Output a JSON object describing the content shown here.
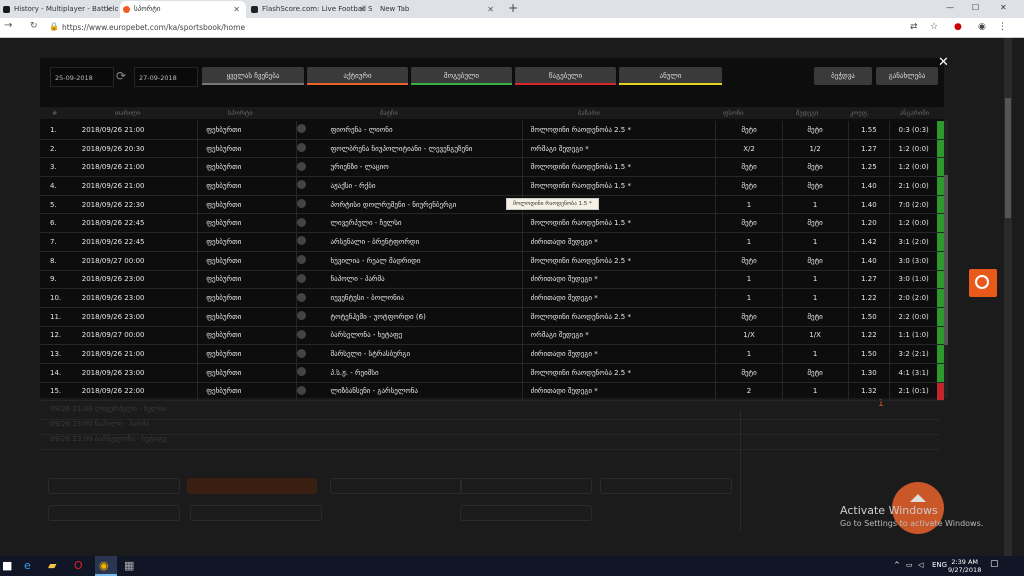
{
  "browser": {
    "tabs": [
      {
        "title": "History - Multiplayer - Battlelog",
        "active": false,
        "favicon_color": "#1a1a1a"
      },
      {
        "title": "სპორტი",
        "active": true,
        "favicon_color": "#f15a24"
      },
      {
        "title": "FlashScore.com: Live Football Sc",
        "active": false,
        "favicon_color": "#222222"
      },
      {
        "title": "New Tab",
        "active": false,
        "favicon_color": ""
      }
    ],
    "url": "https://www.europebet.com/ka/sportsbook/home"
  },
  "filters": {
    "date_from": "25-09-2018",
    "date_to": "27-09-2018",
    "buttons": [
      {
        "label": "ყველას ჩვენება",
        "color": "#777777"
      },
      {
        "label": "აქტიური",
        "color": "#e8622a"
      },
      {
        "label": "მოგებული",
        "color": "#3cb043"
      },
      {
        "label": "წაგებული",
        "color": "#d9262c"
      },
      {
        "label": "ანული",
        "color": "#e6d21e"
      }
    ],
    "right_buttons": [
      "ბეჭდვა",
      "განახლება"
    ]
  },
  "table": {
    "headers": [
      "#",
      "თარიღი",
      "სპორტი",
      "მატჩი",
      "ბაზარი",
      "ფსონი",
      "შედეგი",
      "კოეფ.",
      "ანგარიში"
    ],
    "rows": [
      {
        "num": "1.",
        "date": "2018/09/26 21:00",
        "sport": "ფეხბურთი",
        "match": "ფიორენა - ლიონი",
        "market": "მოლოდინი რაოდენობა 2.5 *",
        "pick": "მეტი",
        "result": "მეტი",
        "odds": "1.55",
        "score": "0:3 (0:3)",
        "status": "won"
      },
      {
        "num": "2.",
        "date": "2018/09/26 20:30",
        "sport": "ფეხბურთი",
        "match": "ფოლბრენა ნიუპოლიტიანი - ლევენგუზენი",
        "market": "ორმაგი შედეგი *",
        "pick": "X/2",
        "result": "1/2",
        "odds": "1.27",
        "score": "1:2 (0:0)",
        "status": "won"
      },
      {
        "num": "3.",
        "date": "2018/09/26 21:00",
        "sport": "ფეხბურთი",
        "match": "ურიენზი - ლაციო",
        "market": "მოლოდინი რაოდენობა 1.5 *",
        "pick": "მეტი",
        "result": "მეტი",
        "odds": "1.25",
        "score": "1:2 (0:0)",
        "status": "won"
      },
      {
        "num": "4.",
        "date": "2018/09/26 21:00",
        "sport": "ფეხბურთი",
        "match": "აჟაქსი - რქბი",
        "market": "მოლოდინი რაოდენობა 1.5 *",
        "pick": "მეტი",
        "result": "მეტი",
        "odds": "1.40",
        "score": "2:1 (0:0)",
        "status": "won"
      },
      {
        "num": "5.",
        "date": "2018/09/26 22:30",
        "sport": "ფეხბურთი",
        "match": "პორტისი დოლრუმენი - ნიურენბერგი",
        "market": "",
        "pick": "1",
        "result": "1",
        "odds": "1.40",
        "score": "7:0 (2:0)",
        "status": "won"
      },
      {
        "num": "6.",
        "date": "2018/09/26 22:45",
        "sport": "ფეხბურთი",
        "match": "ლივერპული - ჩელსი",
        "market": "მოლოდინი რაოდენობა 1.5 *",
        "pick": "მეტი",
        "result": "მეტი",
        "odds": "1.20",
        "score": "1:2 (0:0)",
        "status": "won"
      },
      {
        "num": "7.",
        "date": "2018/09/26 22:45",
        "sport": "ფეხბურთი",
        "match": "არსენალი - ბრენტფორდი",
        "market": "ძირითადი შედეგი *",
        "pick": "1",
        "result": "1",
        "odds": "1.42",
        "score": "3:1 (2:0)",
        "status": "won"
      },
      {
        "num": "8.",
        "date": "2018/09/27 00:00",
        "sport": "ფეხბურთი",
        "match": "ხუვილია - რეალ მადრიდი",
        "market": "მოლოდინი რაოდენობა 2.5 *",
        "pick": "მეტი",
        "result": "მეტი",
        "odds": "1.40",
        "score": "3:0 (3:0)",
        "status": "won"
      },
      {
        "num": "9.",
        "date": "2018/09/26 23:00",
        "sport": "ფეხბურთი",
        "match": "ნაპოლი - პარმა",
        "market": "ძირითადი შედეგი *",
        "pick": "1",
        "result": "1",
        "odds": "1.27",
        "score": "3:0 (1:0)",
        "status": "won"
      },
      {
        "num": "10.",
        "date": "2018/09/26 23:00",
        "sport": "ფეხბურთი",
        "match": "იუვენტუსი - ბოლონია",
        "market": "ძირითადი შედეგი *",
        "pick": "1",
        "result": "1",
        "odds": "1.22",
        "score": "2:0 (2:0)",
        "status": "won"
      },
      {
        "num": "11.",
        "date": "2018/09/26 23:00",
        "sport": "ფეხბურთი",
        "match": "ტოტენჰემი - უოტფორდი (6)",
        "market": "მოლოდინი რაოდენობა 2.5 *",
        "pick": "მეტი",
        "result": "მეტი",
        "odds": "1.50",
        "score": "2:2 (0:0)",
        "status": "won"
      },
      {
        "num": "12.",
        "date": "2018/09/27 00:00",
        "sport": "ფეხბურთი",
        "match": "ბარსელონა - ხეტაფე",
        "market": "ორმაგი შედეგი *",
        "pick": "1/X",
        "result": "1/X",
        "odds": "1.22",
        "score": "1:1 (1:0)",
        "status": "won"
      },
      {
        "num": "13.",
        "date": "2018/09/26 21:00",
        "sport": "ფეხბურთი",
        "match": "მარსელი - სტრასბურგი",
        "market": "ძირითადი შედეგი *",
        "pick": "1",
        "result": "1",
        "odds": "1.50",
        "score": "3:2 (2:1)",
        "status": "won"
      },
      {
        "num": "14.",
        "date": "2018/09/26 23:00",
        "sport": "ფეხბურთი",
        "match": "პ.ს.ჟ. - რეიმსი",
        "market": "მოლოდინი რაოდენობა 2.5 *",
        "pick": "მეტი",
        "result": "მეტი",
        "odds": "1.30",
        "score": "4:1 (3:1)",
        "status": "won"
      },
      {
        "num": "15.",
        "date": "2018/09/26 22:00",
        "sport": "ფეხბურთი",
        "match": "ლიზბანსენი - გარსელონა",
        "market": "ძირითადი შედეგი *",
        "pick": "2",
        "result": "1",
        "odds": "1.32",
        "score": "2:1 (0:1)",
        "status": "lost"
      }
    ],
    "tooltip": "მოლოდინი რაოდენობა 1.5 *"
  },
  "status_colors": {
    "won": "#2e9a2e",
    "lost": "#c0262c"
  },
  "background": {
    "rows": [
      "09/26 21:00  ლივერპული - ჩელსი",
      "09/26 23:00  ნაპოლი - პარმა",
      "09/26 23:00  ბარსელონა - ხეტაფე"
    ],
    "page_number": "1"
  },
  "windows_activation": {
    "title": "Activate Windows",
    "subtitle": "Go to Settings to activate Windows."
  },
  "taskbar": {
    "time": "2:39 AM",
    "date": "9/27/2018",
    "lang": "ENG"
  }
}
